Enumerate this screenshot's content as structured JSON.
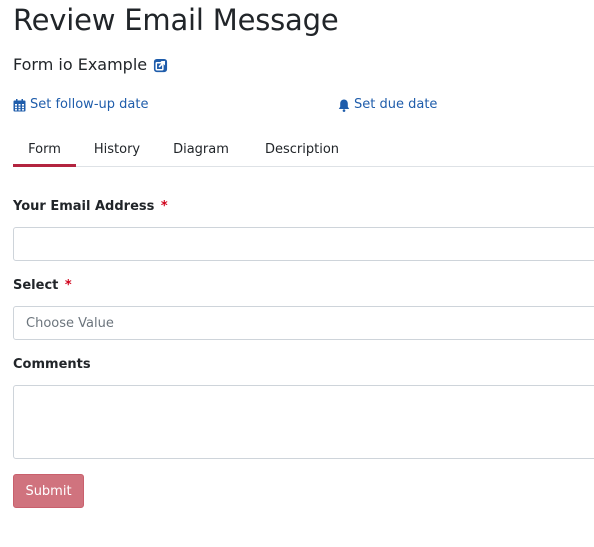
{
  "header": {
    "title": "Review Email Message",
    "process_name": "Form io Example",
    "external_link_icon": "external-link-icon"
  },
  "actions": {
    "follow_up": {
      "label": "Set follow-up date",
      "icon": "calendar-icon"
    },
    "due_date": {
      "label": "Set due date",
      "icon": "bell-icon"
    }
  },
  "tabs": [
    {
      "label": "Form",
      "active": true
    },
    {
      "label": "History",
      "active": false
    },
    {
      "label": "Diagram",
      "active": false
    },
    {
      "label": "Description",
      "active": false
    }
  ],
  "form": {
    "email": {
      "label": "Your Email Address",
      "required_mark": "*",
      "value": ""
    },
    "select": {
      "label": "Select",
      "required_mark": "*",
      "placeholder": "Choose Value"
    },
    "comments": {
      "label": "Comments",
      "value": ""
    },
    "submit_label": "Submit"
  },
  "colors": {
    "link": "#1f5dab",
    "active_tab_underline": "#b3243f",
    "required": "#d0021b",
    "submit_bg": "#d0737e"
  }
}
